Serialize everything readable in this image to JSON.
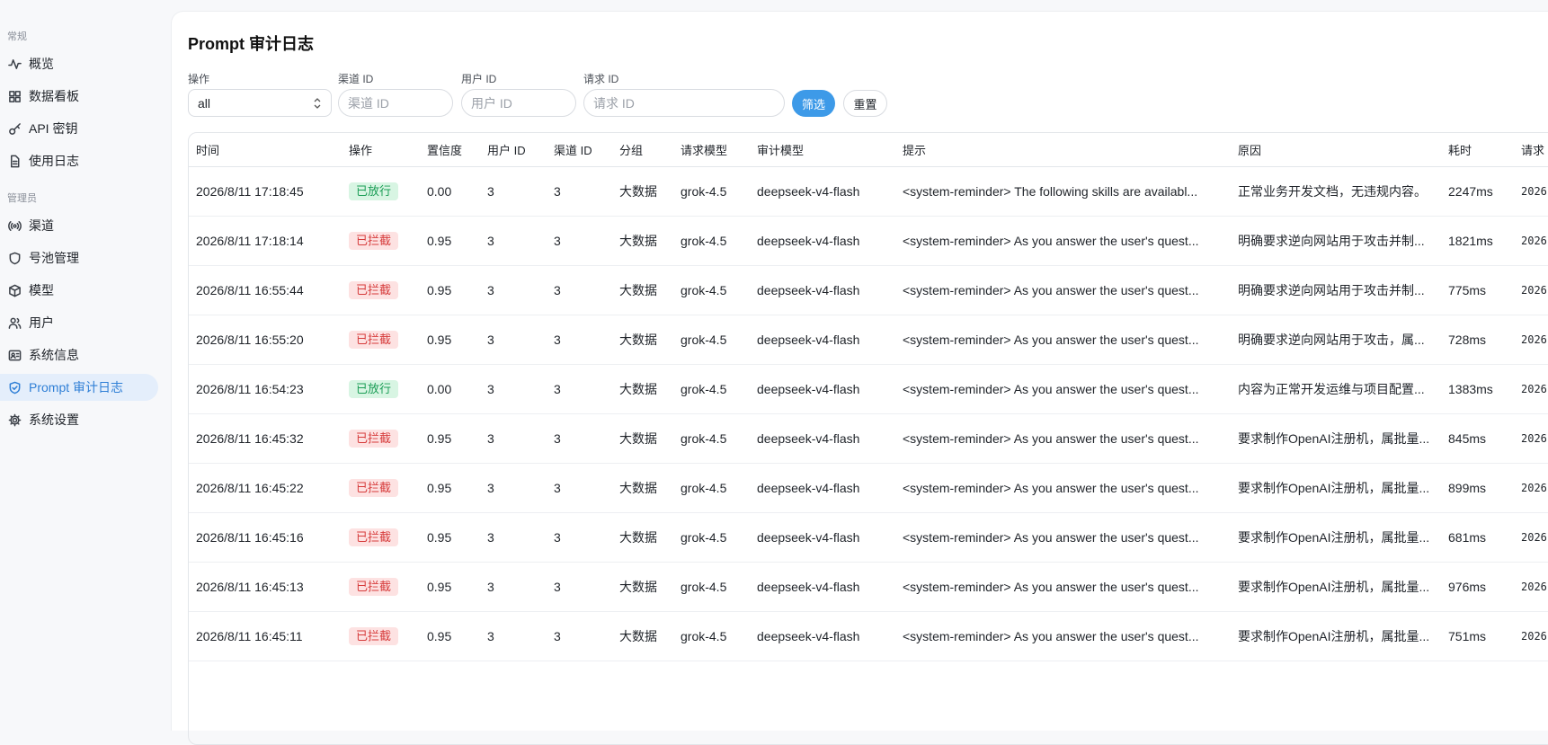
{
  "sidebar": {
    "section_general": "常规",
    "section_admin": "管理员",
    "general_items": [
      {
        "label": "概览",
        "icon": "activity-icon"
      },
      {
        "label": "数据看板",
        "icon": "dashboard-grid-icon"
      },
      {
        "label": "API 密钥",
        "icon": "key-icon"
      },
      {
        "label": "使用日志",
        "icon": "document-icon"
      }
    ],
    "admin_items": [
      {
        "label": "渠道",
        "icon": "broadcast-icon"
      },
      {
        "label": "号池管理",
        "icon": "shield-icon"
      },
      {
        "label": "模型",
        "icon": "cube-icon"
      },
      {
        "label": "用户",
        "icon": "users-icon"
      },
      {
        "label": "系统信息",
        "icon": "server-info-icon"
      },
      {
        "label": "Prompt 审计日志",
        "icon": "shield-check-icon",
        "active": true
      },
      {
        "label": "系统设置",
        "icon": "gear-icon"
      }
    ]
  },
  "page": {
    "title": "Prompt 审计日志"
  },
  "filters": {
    "action_label": "操作",
    "action_value": "all",
    "channel_label": "渠道 ID",
    "channel_placeholder": "渠道 ID",
    "user_label": "用户 ID",
    "user_placeholder": "用户 ID",
    "request_label": "请求 ID",
    "request_placeholder": "请求 ID",
    "filter_button": "筛选",
    "reset_button": "重置"
  },
  "table": {
    "columns": [
      "时间",
      "操作",
      "置信度",
      "用户 ID",
      "渠道 ID",
      "分组",
      "请求模型",
      "审计模型",
      "提示",
      "原因",
      "耗时",
      "请求"
    ],
    "rows": [
      {
        "time": "2026/8/11 17:18:45",
        "action": "已放行",
        "status": "allow",
        "confidence": "0.00",
        "user_id": "3",
        "channel_id": "3",
        "group": "大数据",
        "req_model": "grok-4.5",
        "audit_model": "deepseek-v4-flash",
        "prompt": "<system-reminder> The following skills are availabl...",
        "reason": "正常业务开发文档，无违规内容。",
        "latency": "2247ms",
        "request": "2026"
      },
      {
        "time": "2026/8/11 17:18:14",
        "action": "已拦截",
        "status": "block",
        "confidence": "0.95",
        "user_id": "3",
        "channel_id": "3",
        "group": "大数据",
        "req_model": "grok-4.5",
        "audit_model": "deepseek-v4-flash",
        "prompt": "<system-reminder> As you answer the user's quest...",
        "reason": "明确要求逆向网站用于攻击并制...",
        "latency": "1821ms",
        "request": "2026"
      },
      {
        "time": "2026/8/11 16:55:44",
        "action": "已拦截",
        "status": "block",
        "confidence": "0.95",
        "user_id": "3",
        "channel_id": "3",
        "group": "大数据",
        "req_model": "grok-4.5",
        "audit_model": "deepseek-v4-flash",
        "prompt": "<system-reminder> As you answer the user's quest...",
        "reason": "明确要求逆向网站用于攻击并制...",
        "latency": "775ms",
        "request": "2026"
      },
      {
        "time": "2026/8/11 16:55:20",
        "action": "已拦截",
        "status": "block",
        "confidence": "0.95",
        "user_id": "3",
        "channel_id": "3",
        "group": "大数据",
        "req_model": "grok-4.5",
        "audit_model": "deepseek-v4-flash",
        "prompt": "<system-reminder> As you answer the user's quest...",
        "reason": "明确要求逆向网站用于攻击，属...",
        "latency": "728ms",
        "request": "2026"
      },
      {
        "time": "2026/8/11 16:54:23",
        "action": "已放行",
        "status": "allow",
        "confidence": "0.00",
        "user_id": "3",
        "channel_id": "3",
        "group": "大数据",
        "req_model": "grok-4.5",
        "audit_model": "deepseek-v4-flash",
        "prompt": "<system-reminder> As you answer the user's quest...",
        "reason": "内容为正常开发运维与项目配置...",
        "latency": "1383ms",
        "request": "2026"
      },
      {
        "time": "2026/8/11 16:45:32",
        "action": "已拦截",
        "status": "block",
        "confidence": "0.95",
        "user_id": "3",
        "channel_id": "3",
        "group": "大数据",
        "req_model": "grok-4.5",
        "audit_model": "deepseek-v4-flash",
        "prompt": "<system-reminder> As you answer the user's quest...",
        "reason": "要求制作OpenAI注册机，属批量...",
        "latency": "845ms",
        "request": "2026"
      },
      {
        "time": "2026/8/11 16:45:22",
        "action": "已拦截",
        "status": "block",
        "confidence": "0.95",
        "user_id": "3",
        "channel_id": "3",
        "group": "大数据",
        "req_model": "grok-4.5",
        "audit_model": "deepseek-v4-flash",
        "prompt": "<system-reminder> As you answer the user's quest...",
        "reason": "要求制作OpenAI注册机，属批量...",
        "latency": "899ms",
        "request": "2026"
      },
      {
        "time": "2026/8/11 16:45:16",
        "action": "已拦截",
        "status": "block",
        "confidence": "0.95",
        "user_id": "3",
        "channel_id": "3",
        "group": "大数据",
        "req_model": "grok-4.5",
        "audit_model": "deepseek-v4-flash",
        "prompt": "<system-reminder> As you answer the user's quest...",
        "reason": "要求制作OpenAI注册机，属批量...",
        "latency": "681ms",
        "request": "2026"
      },
      {
        "time": "2026/8/11 16:45:13",
        "action": "已拦截",
        "status": "block",
        "confidence": "0.95",
        "user_id": "3",
        "channel_id": "3",
        "group": "大数据",
        "req_model": "grok-4.5",
        "audit_model": "deepseek-v4-flash",
        "prompt": "<system-reminder> As you answer the user's quest...",
        "reason": "要求制作OpenAI注册机，属批量...",
        "latency": "976ms",
        "request": "2026"
      },
      {
        "time": "2026/8/11 16:45:11",
        "action": "已拦截",
        "status": "block",
        "confidence": "0.95",
        "user_id": "3",
        "channel_id": "3",
        "group": "大数据",
        "req_model": "grok-4.5",
        "audit_model": "deepseek-v4-flash",
        "prompt": "<system-reminder> As you answer the user's quest...",
        "reason": "要求制作OpenAI注册机，属批量...",
        "latency": "751ms",
        "request": "2026"
      }
    ]
  },
  "colors": {
    "accent": "#3d9ae8",
    "allow_bg": "#d8f5e3",
    "allow_fg": "#1a9d55",
    "block_bg": "#fde2e2",
    "block_fg": "#d63b3b"
  }
}
